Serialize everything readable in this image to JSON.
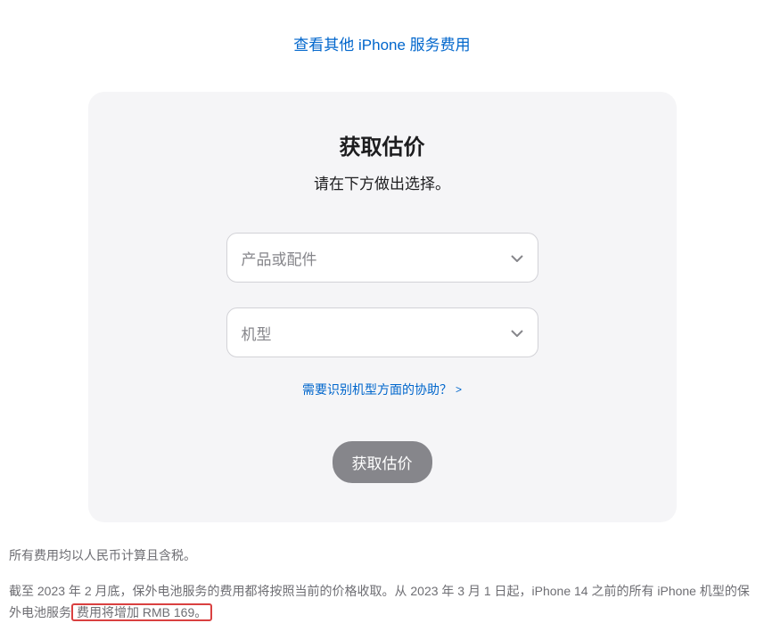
{
  "topLink": {
    "label": "查看其他 iPhone 服务费用"
  },
  "card": {
    "title": "获取估价",
    "subtitle": "请在下方做出选择。",
    "select1": {
      "placeholder": "产品或配件"
    },
    "select2": {
      "placeholder": "机型"
    },
    "helpLink": {
      "label": "需要识别机型方面的协助？",
      "arrow": ">"
    },
    "submit": {
      "label": "获取估价"
    }
  },
  "footer": {
    "line1": "所有费用均以人民币计算且含税。",
    "line2_pre": "截至 2023 年 2 月底，保外电池服务的费用都将按照当前的价格收取。从 2023 年 3 月 1 日起，iPhone 14 之前的所有 iPhone 机型的保外电池服务",
    "line2_highlight": "费用将增加 RMB 169。"
  }
}
